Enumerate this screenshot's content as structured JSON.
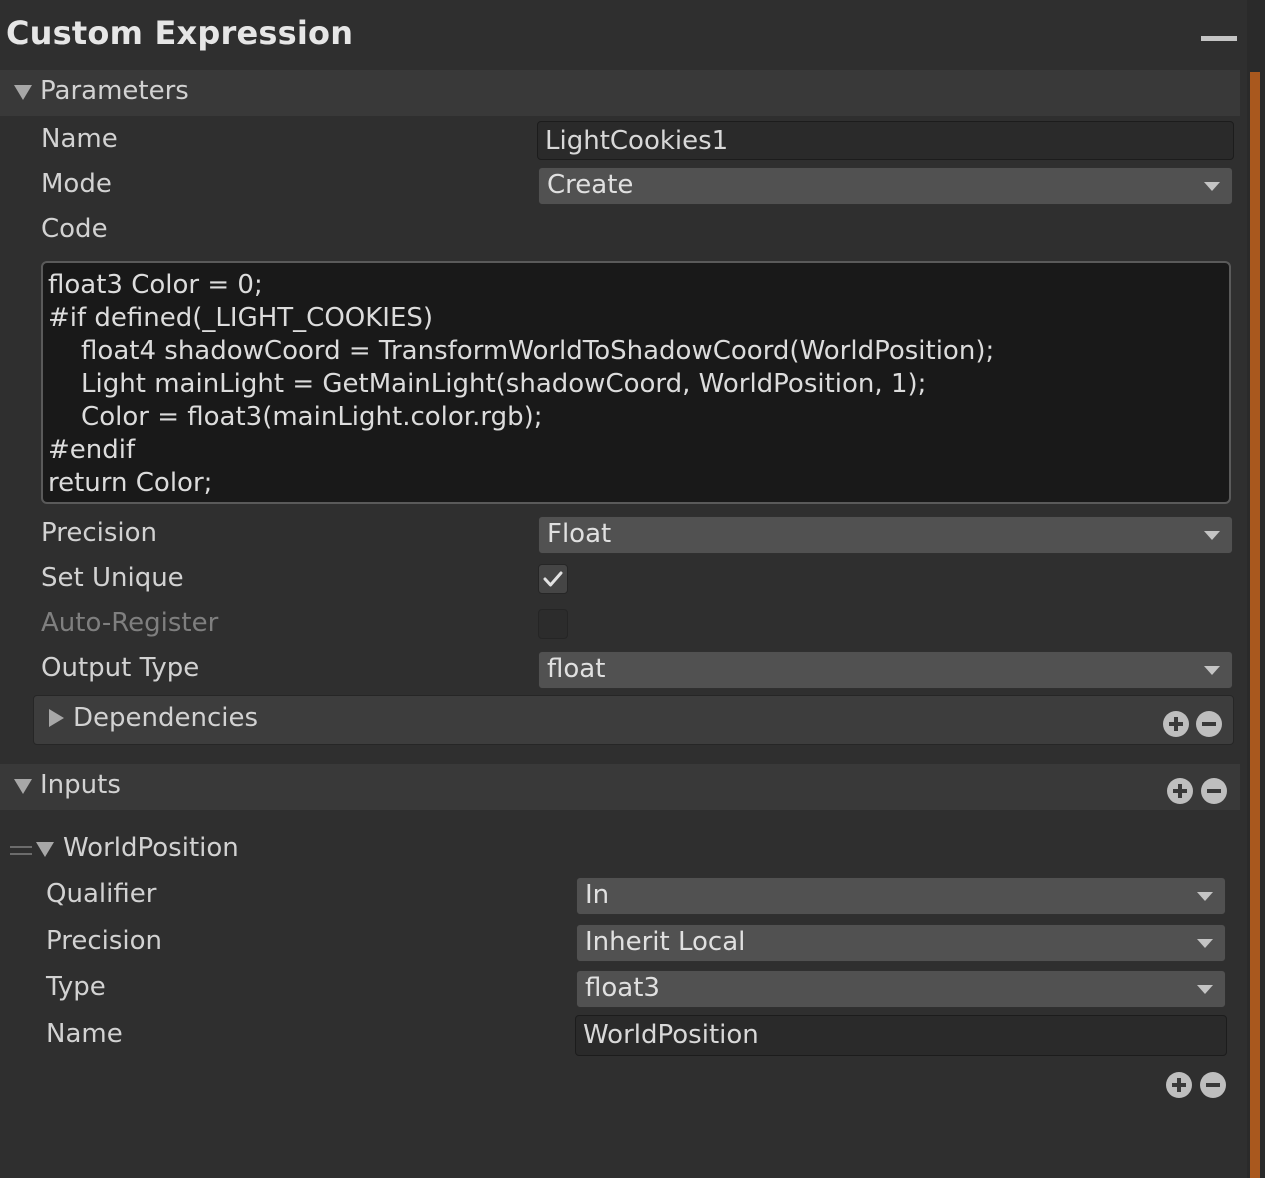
{
  "header": {
    "title": "Custom Expression"
  },
  "parameters": {
    "section_label": "Parameters",
    "name_label": "Name",
    "name_value": "LightCookies1",
    "mode_label": "Mode",
    "mode_value": "Create",
    "code_label": "Code",
    "code_value": "float3 Color = 0;\n#if defined(_LIGHT_COOKIES)\n    float4 shadowCoord = TransformWorldToShadowCoord(WorldPosition);\n    Light mainLight = GetMainLight(shadowCoord, WorldPosition, 1);\n    Color = float3(mainLight.color.rgb);\n#endif\nreturn Color;",
    "precision_label": "Precision",
    "precision_value": "Float",
    "set_unique_label": "Set Unique",
    "set_unique_checked": true,
    "auto_register_label": "Auto-Register",
    "auto_register_checked": false,
    "output_type_label": "Output Type",
    "output_type_value": "float",
    "dependencies_label": "Dependencies"
  },
  "inputs": {
    "section_label": "Inputs",
    "items": [
      {
        "name": "WorldPosition",
        "qualifier_label": "Qualifier",
        "qualifier_value": "In",
        "precision_label": "Precision",
        "precision_value": "Inherit Local",
        "type_label": "Type",
        "type_value": "float3",
        "name_label": "Name",
        "name_value": "WorldPosition"
      }
    ]
  },
  "colors": {
    "background": "#2f2f2f",
    "section_bar": "#393939",
    "dropdown": "#515151",
    "text_field": "#2a2a2a",
    "code_background": "#191919",
    "scrollbar_accent": "#a9581e"
  }
}
